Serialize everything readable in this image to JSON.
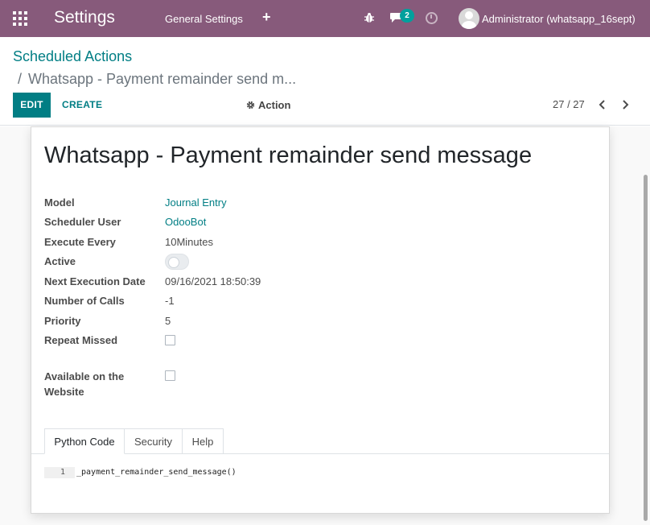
{
  "navbar": {
    "app_title": "Settings",
    "menu_item": "General Settings",
    "plus_glyph": "+",
    "chat_badge": "2",
    "user_name": "Administrator (whatsapp_16sept)"
  },
  "breadcrumb": {
    "parent": "Scheduled Actions",
    "separator": "/",
    "current": "Whatsapp - Payment remainder send m..."
  },
  "toolbar": {
    "edit_label": "EDIT",
    "create_label": "CREATE",
    "action_label": "Action",
    "pager": "27 / 27"
  },
  "record": {
    "title": "Whatsapp - Payment remainder send message",
    "fields": {
      "model_label": "Model",
      "model_value": "Journal Entry",
      "user_label": "Scheduler User",
      "user_value": "OdooBot",
      "interval_label": "Execute Every",
      "interval_value": "10Minutes",
      "active_label": "Active",
      "active_value": false,
      "nextcall_label": "Next Execution Date",
      "nextcall_value": "09/16/2021 18:50:39",
      "numcall_label": "Number of Calls",
      "numcall_value": "-1",
      "priority_label": "Priority",
      "priority_value": "5",
      "repeat_label": "Repeat Missed",
      "repeat_value": false,
      "website_label_line1": "Available on the",
      "website_label_line2": "Website",
      "website_value": false
    }
  },
  "tabs": {
    "python": "Python Code",
    "security": "Security",
    "help": "Help",
    "active": "Python Code"
  },
  "code": {
    "line_number": "1",
    "line_text": "_payment_remainder_send_message()"
  },
  "colors": {
    "navbar": "#875a7b",
    "primary": "#017e84",
    "badge": "#00a09d"
  },
  "icons": [
    "apps-grid-icon",
    "plus-icon",
    "bug-icon",
    "chat-icon",
    "clock-icon",
    "user-avatar-icon",
    "gear-icon",
    "chevron-left-icon",
    "chevron-right-icon"
  ]
}
